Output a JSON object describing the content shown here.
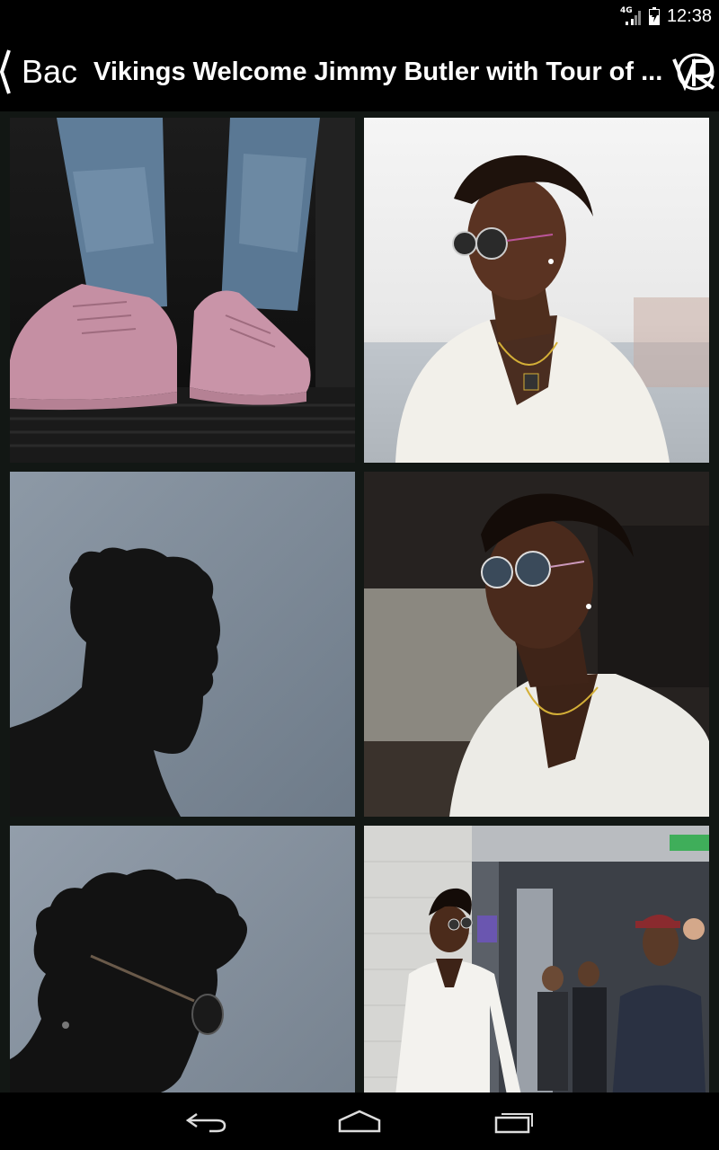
{
  "status_bar": {
    "network_label": "4G",
    "time": "12:38",
    "signal_icon": "signal-icon",
    "battery_icon": "battery-icon"
  },
  "app_bar": {
    "back_label": "Bac",
    "back_icon": "chevron-left-icon",
    "title": "Vikings Welcome Jimmy Butler with Tour of ...",
    "logo_icon": "vr-logo-icon"
  },
  "gallery": {
    "photos": [
      {
        "subject": "pink sneakers and jeans on escalator"
      },
      {
        "subject": "man in round sunglasses and white shirt, light background"
      },
      {
        "subject": "silhouette of man against gray sky"
      },
      {
        "subject": "man in sunglasses and white shirt, dark background"
      },
      {
        "subject": "silhouette of man with glasses against gray sky"
      },
      {
        "subject": "man in white outfit walking in arena hallway"
      }
    ]
  },
  "nav_bar": {
    "back_icon": "back-arrow-icon",
    "home_icon": "home-icon",
    "recents_icon": "recents-icon"
  },
  "colors": {
    "background": "#121714",
    "bars": "#000000",
    "text": "#ffffff"
  }
}
